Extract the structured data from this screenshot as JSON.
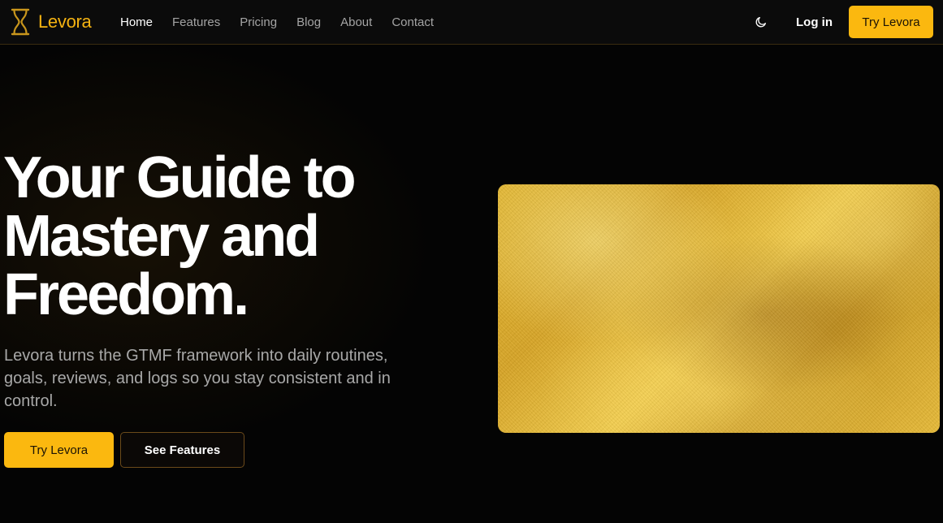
{
  "brand": {
    "name": "Levora",
    "accent": "#f5b312",
    "icon": "hourglass-icon"
  },
  "nav": {
    "items": [
      {
        "label": "Home",
        "active": true
      },
      {
        "label": "Features",
        "active": false
      },
      {
        "label": "Pricing",
        "active": false
      },
      {
        "label": "Blog",
        "active": false
      },
      {
        "label": "About",
        "active": false
      },
      {
        "label": "Contact",
        "active": false
      }
    ],
    "theme_toggle_icon": "moon-icon",
    "login_label": "Log in",
    "cta_label": "Try Levora"
  },
  "hero": {
    "title_lines": [
      "Your Guide to",
      "Mastery and",
      "Freedom."
    ],
    "subtitle": "Levora turns the GTMF framework into daily routines, goals, reviews, and logs so you stay consistent and in control.",
    "primary_cta": "Try Levora",
    "secondary_cta": "See Features"
  },
  "colors": {
    "accent": "#fbb80f",
    "background": "#040404",
    "nav_inactive": "#a4a4a4",
    "nav_active": "#ffffff"
  }
}
